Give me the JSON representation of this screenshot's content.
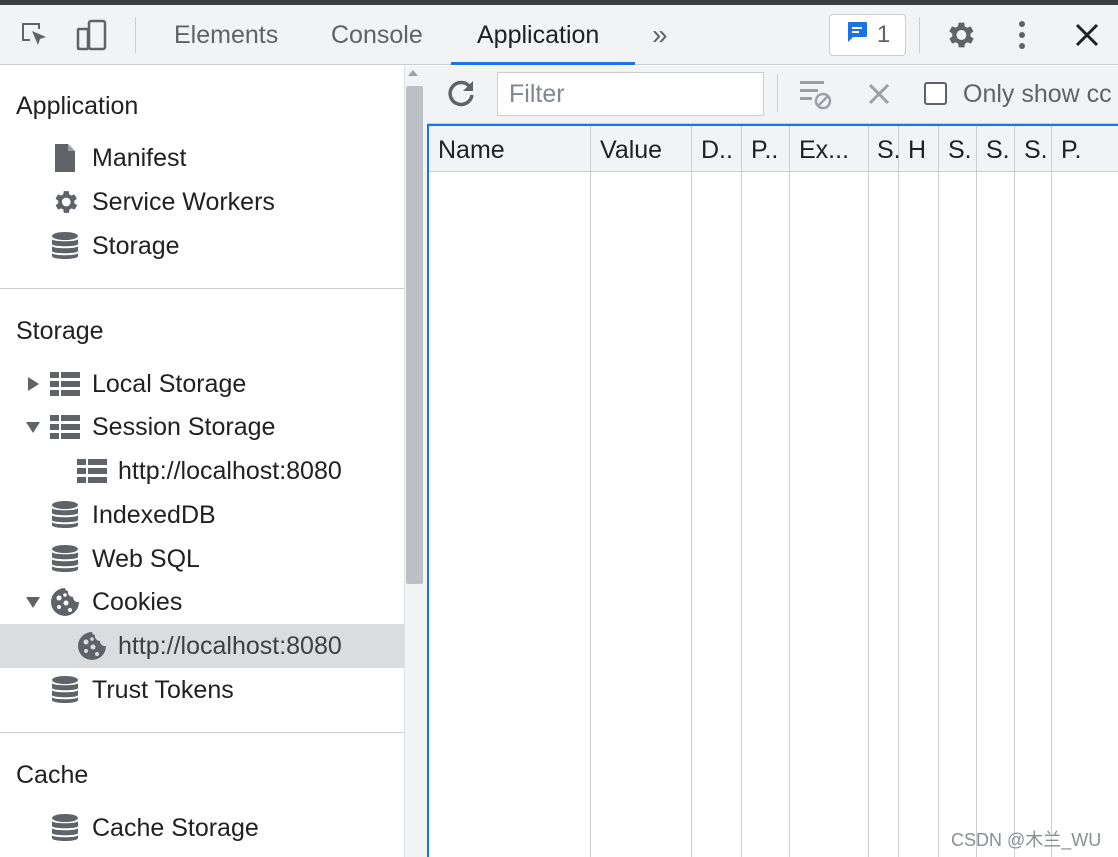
{
  "toolbar": {
    "tabs": [
      {
        "label": "Elements"
      },
      {
        "label": "Console"
      },
      {
        "label": "Application"
      }
    ],
    "more_tabs_glyph": "»",
    "issues_count": "1",
    "icons": [
      "inspect-icon",
      "device-toggle-icon",
      "more-tabs-icon",
      "message-icon",
      "gear-icon",
      "kebab-menu-icon",
      "close-icon"
    ]
  },
  "sidebar": {
    "sections": [
      {
        "title": "Application",
        "items": [
          {
            "label": "Manifest",
            "icon": "file-icon"
          },
          {
            "label": "Service Workers",
            "icon": "gear-icon"
          },
          {
            "label": "Storage",
            "icon": "database-icon"
          }
        ]
      },
      {
        "title": "Storage",
        "items": [
          {
            "label": "Local Storage",
            "icon": "table-icon",
            "expanded": false
          },
          {
            "label": "Session Storage",
            "icon": "table-icon",
            "expanded": true
          },
          {
            "label": "http://localhost:8080",
            "icon": "table-icon",
            "child": true
          },
          {
            "label": "IndexedDB",
            "icon": "database-icon"
          },
          {
            "label": "Web SQL",
            "icon": "database-icon"
          },
          {
            "label": "Cookies",
            "icon": "cookie-icon",
            "expanded": true
          },
          {
            "label": "http://localhost:8080",
            "icon": "cookie-icon",
            "child": true,
            "selected": true
          },
          {
            "label": "Trust Tokens",
            "icon": "database-icon"
          }
        ]
      },
      {
        "title": "Cache",
        "items": [
          {
            "label": "Cache Storage",
            "icon": "database-icon"
          }
        ]
      }
    ]
  },
  "main": {
    "filter_placeholder": "Filter",
    "only_show_label": "Only show cc",
    "columns": [
      "Name",
      "Value",
      "D..",
      "P..",
      "Ex...",
      "S.",
      "H",
      "S.",
      "S.",
      "S.",
      "P."
    ]
  },
  "watermark": "CSDN @木兰_WU",
  "colors": {
    "accent": "#1a73e8",
    "toolbar_bg": "#f1f3f4",
    "selected_bg": "#dadce0",
    "icon_gray": "#5f6368"
  }
}
